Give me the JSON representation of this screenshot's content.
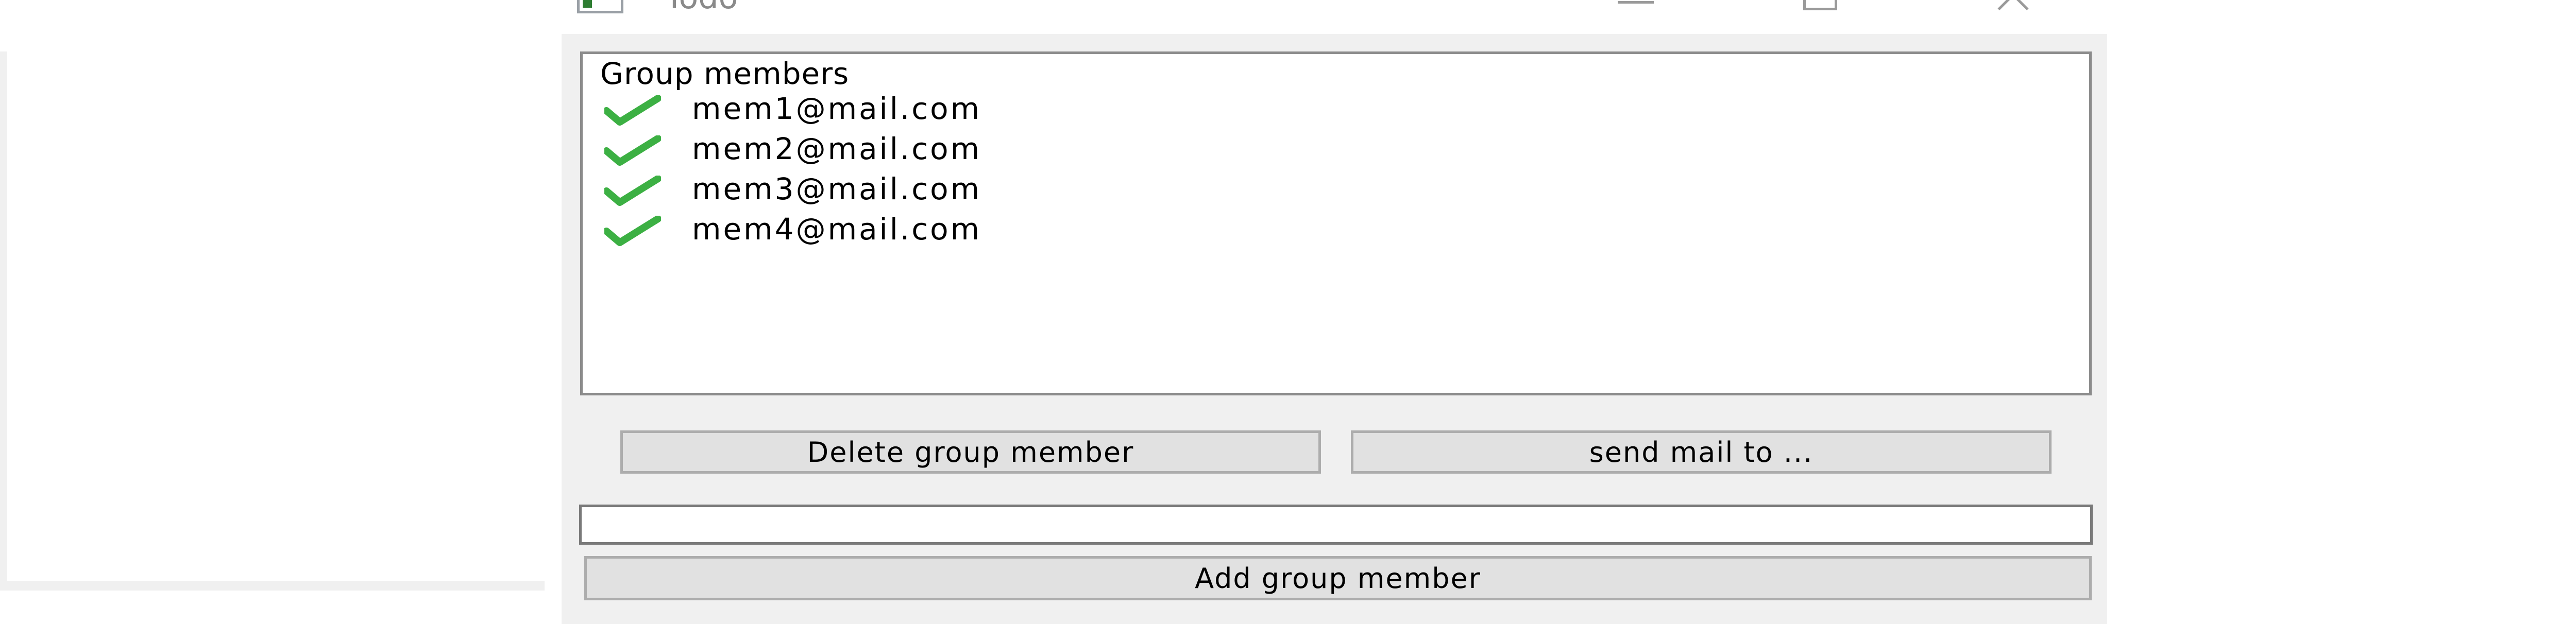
{
  "window": {
    "title": "Todo"
  },
  "list": {
    "header": "Group members",
    "members": [
      {
        "email": "mem1@mail.com",
        "icon": "check-icon",
        "icon_color": "#3cb043"
      },
      {
        "email": "mem2@mail.com",
        "icon": "check-icon",
        "icon_color": "#3cb043"
      },
      {
        "email": "mem3@mail.com",
        "icon": "check-icon",
        "icon_color": "#3cb043"
      },
      {
        "email": "mem4@mail.com",
        "icon": "check-icon",
        "icon_color": "#3cb043"
      }
    ]
  },
  "buttons": {
    "delete_label": "Delete group member",
    "send_label": "send mail to ...",
    "add_label": "Add group member"
  },
  "input": {
    "value": "",
    "placeholder": ""
  }
}
